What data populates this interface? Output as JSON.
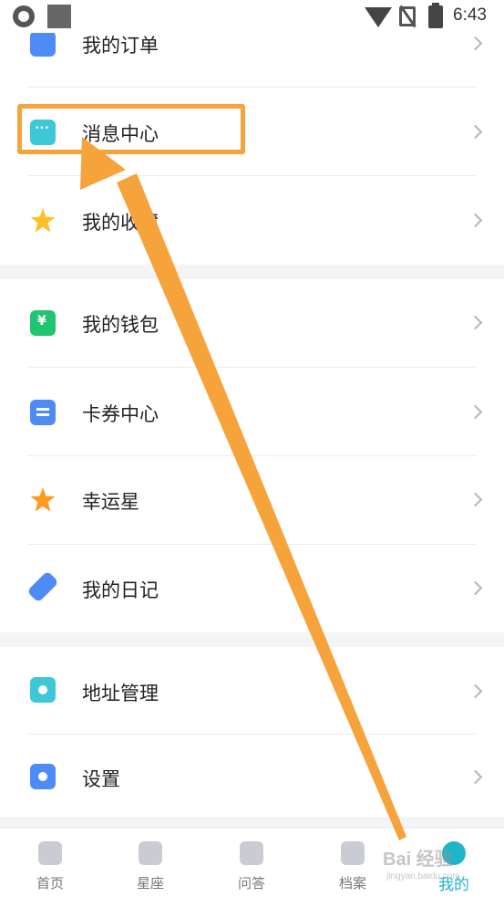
{
  "status_bar": {
    "time": "6:43",
    "icons": [
      "app-icon",
      "image-icon",
      "wifi-icon",
      "no-sim-icon",
      "battery-charging-icon"
    ]
  },
  "menu": {
    "group1": [
      {
        "label": "我的订单",
        "icon": "order-icon"
      },
      {
        "label": "消息中心",
        "icon": "message-icon"
      },
      {
        "label": "我的收藏",
        "icon": "favorite-star-icon"
      }
    ],
    "group2": [
      {
        "label": "我的钱包",
        "icon": "wallet-icon"
      },
      {
        "label": "卡券中心",
        "icon": "coupon-icon"
      },
      {
        "label": "幸运星",
        "icon": "lucky-star-icon"
      },
      {
        "label": "我的日记",
        "icon": "diary-pen-icon"
      }
    ],
    "group3": [
      {
        "label": "地址管理",
        "icon": "location-pin-icon"
      },
      {
        "label": "设置",
        "icon": "settings-gear-icon"
      }
    ]
  },
  "tabbar": {
    "tabs": [
      {
        "label": "首页",
        "icon": "home-icon"
      },
      {
        "label": "星座",
        "icon": "constellation-icon"
      },
      {
        "label": "问答",
        "icon": "qa-icon"
      },
      {
        "label": "档案",
        "icon": "archive-icon"
      },
      {
        "label": "我的",
        "icon": "profile-icon"
      }
    ],
    "active_index": 4
  },
  "annotation": {
    "highlight_color": "#f7a33b",
    "arrow_color": "#f7a33b"
  },
  "watermark": {
    "text": "Bai 经验",
    "sub": "jingyan.baidu.com"
  },
  "colors": {
    "accent": "#1fb5c9",
    "blue": "#4e8cf5",
    "separator_bg": "#f3f4f6"
  }
}
